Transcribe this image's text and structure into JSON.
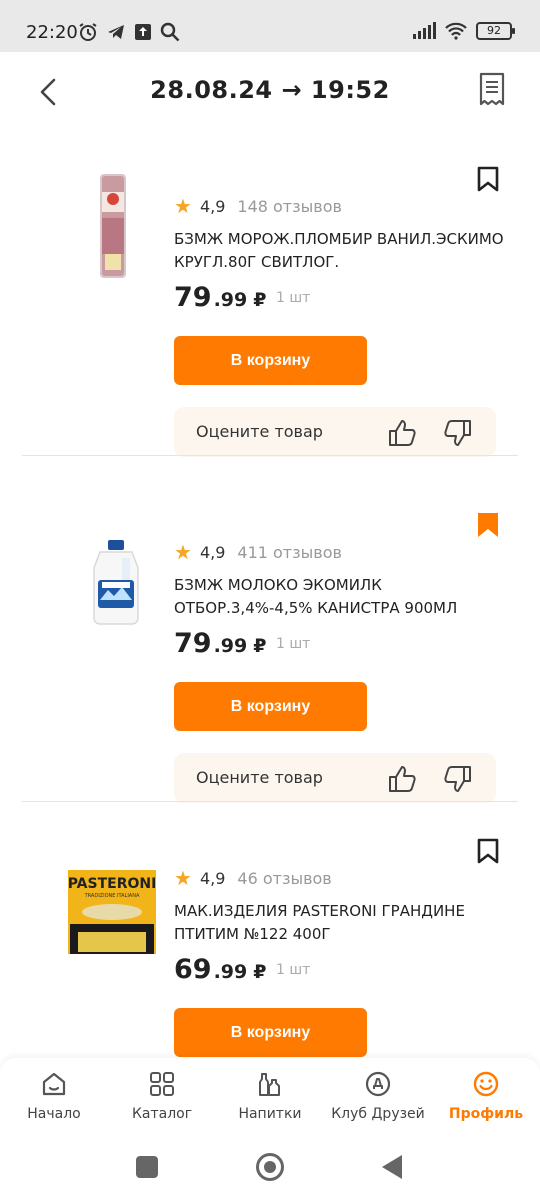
{
  "status_bar": {
    "time": "22:20",
    "battery": "92",
    "left_icons": [
      "alarm-icon",
      "telegram-icon",
      "upload-icon",
      "search-icon"
    ],
    "right_icons": [
      "signal-icon",
      "wifi-icon",
      "battery-icon"
    ]
  },
  "header": {
    "title": "28.08.24 → 19:52",
    "back_icon": "chevron-left-icon",
    "receipt_icon": "receipt-icon"
  },
  "colors": {
    "accent": "#ff7a00",
    "star": "#f5a623",
    "rate_box_bg": "#fdf6ee"
  },
  "products": [
    {
      "rating": "4,9",
      "reviews": "148 отзывов",
      "name": "БЗМЖ МОРОЖ.ПЛОМБИР ВАНИЛ.ЭСКИМО КРУГЛ.80Г СВИТЛОГ.",
      "price_rub": "79",
      "price_kop": ".99",
      "currency": "₽",
      "qty": "1 шт",
      "cart_label": "В корзину",
      "rate_label": "Оцените товар",
      "bookmarked": false,
      "image": "ice-cream-image"
    },
    {
      "rating": "4,9",
      "reviews": "411 отзывов",
      "name": "БЗМЖ МОЛОКО ЭКОМИЛК ОТБОР.3,4%-4,5% КАНИСТРА 900МЛ",
      "price_rub": "79",
      "price_kop": ".99",
      "currency": "₽",
      "qty": "1 шт",
      "cart_label": "В корзину",
      "rate_label": "Оцените товар",
      "bookmarked": true,
      "image": "milk-bottle-image"
    },
    {
      "rating": "4,9",
      "reviews": "46 отзывов",
      "name": "МАК.ИЗДЕЛИЯ PASTERONI ГРАНДИНЕ ПТИТИМ №122 400Г",
      "price_rub": "69",
      "price_kop": ".99",
      "currency": "₽",
      "qty": "1 шт",
      "cart_label": "В корзину",
      "bookmarked": false,
      "image": "pasteroni-pack-image",
      "pack_brand": "PASTERONI",
      "pack_subtitle": "TRADIZIONE ITALIANA"
    }
  ],
  "bottom_nav": [
    {
      "label": "Начало",
      "icon": "home-icon",
      "active": false
    },
    {
      "label": "Каталог",
      "icon": "grid-icon",
      "active": false
    },
    {
      "label": "Напитки",
      "icon": "bottles-icon",
      "active": false
    },
    {
      "label": "Клуб Друзей",
      "icon": "club-badge-icon",
      "active": false
    },
    {
      "label": "Профиль",
      "icon": "smile-icon",
      "active": true
    }
  ]
}
